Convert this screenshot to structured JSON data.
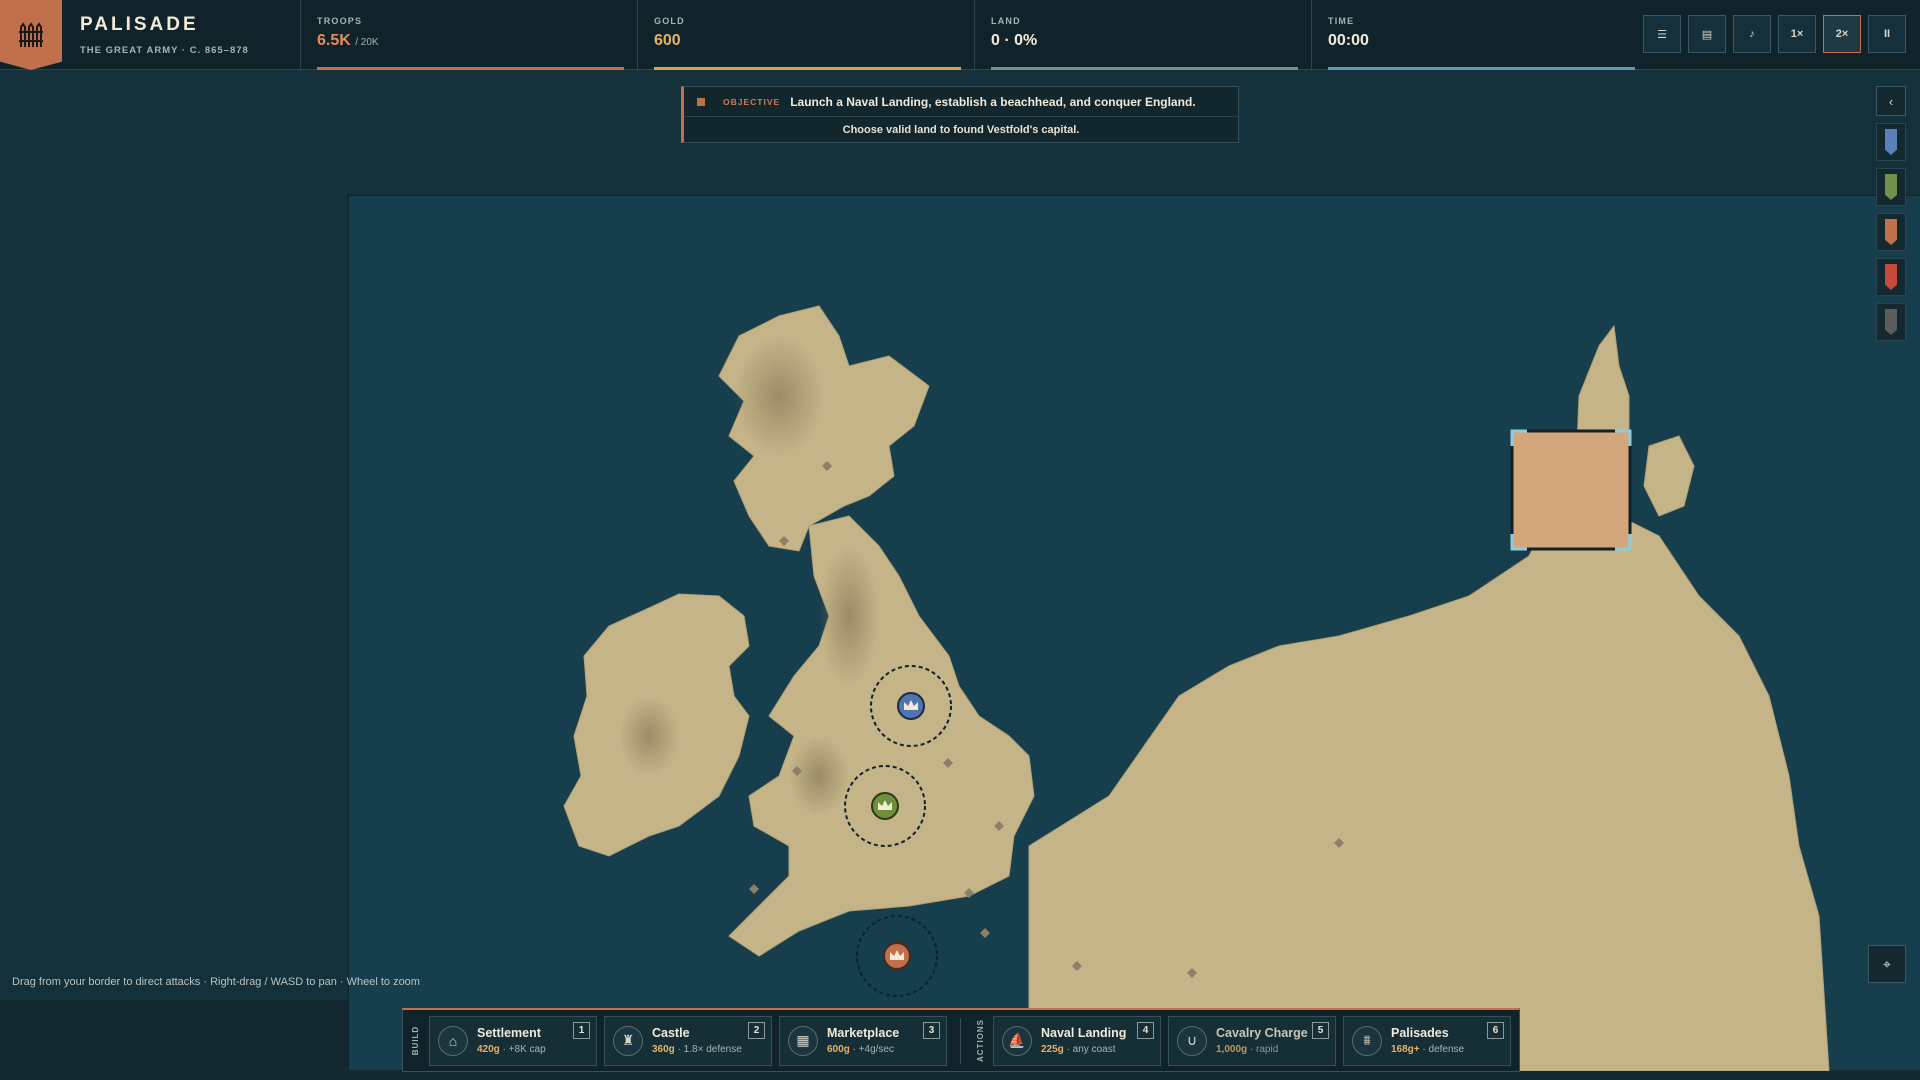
{
  "app": {
    "title": "PALISADE",
    "subtitle": "THE GREAT ARMY · C. 865–878",
    "logo_icon": "palisade-fence-icon"
  },
  "stats": {
    "troops": {
      "label": "TROOPS",
      "value": "6.5K",
      "max": "/ 20K",
      "fill": 1.0,
      "color": "#c0704a"
    },
    "gold": {
      "label": "GOLD",
      "value": "600",
      "fill": 1.0,
      "color": "#d6a25a"
    },
    "land": {
      "label": "LAND",
      "value": "0 · 0%",
      "fill": 1.0,
      "color": "#7a8d8f"
    },
    "time": {
      "label": "TIME",
      "value": "00:00",
      "fill": 1.0,
      "color": "#5a9db0"
    }
  },
  "controls": [
    {
      "name": "menu-button",
      "label": "☰"
    },
    {
      "name": "ledger-button",
      "label": "▤"
    },
    {
      "name": "music-button",
      "label": "♪"
    },
    {
      "name": "speed-1x-button",
      "label": "1×"
    },
    {
      "name": "speed-2x-button",
      "label": "2×",
      "active": true
    },
    {
      "name": "pause-button",
      "label": "II"
    }
  ],
  "objective": {
    "label": "OBJECTIVE",
    "text": "Launch a Naval Landing, establish a beachhead, and conquer England.",
    "instruction": "Choose valid land to found Vestfold's capital."
  },
  "side_panel": {
    "collapse_icon": "‹",
    "banners": [
      "#5b7fb8",
      "#6f8f4a",
      "#c0704a",
      "#c44a3a",
      "#5d5d5d"
    ]
  },
  "map": {
    "capitals": [
      {
        "name": "blue-capital",
        "color": "#4f74b0"
      },
      {
        "name": "green-capital",
        "color": "#6f8f3a"
      },
      {
        "name": "orange-capital",
        "color": "#c0704a"
      }
    ],
    "land_color": "#c4b487",
    "sea_color": "#163e4d"
  },
  "hint": "Drag from your border to direct attacks · Right-drag / WASD to pan · Wheel to zoom",
  "buildbar": {
    "build_label": "BUILD",
    "actions_label": "ACTIONS",
    "build": [
      {
        "name": "settlement",
        "label": "Settlement",
        "cost": "420g",
        "detail": "· +8K cap",
        "key": "1",
        "icon": "⌂"
      },
      {
        "name": "castle",
        "label": "Castle",
        "cost": "360g",
        "detail": "· 1.8× defense",
        "key": "2",
        "icon": "♜"
      },
      {
        "name": "marketplace",
        "label": "Marketplace",
        "cost": "600g",
        "detail": "· +4g/sec",
        "key": "3",
        "icon": "▦"
      }
    ],
    "actions": [
      {
        "name": "naval-landing",
        "label": "Naval Landing",
        "cost": "225g",
        "detail": "· any coast",
        "key": "4",
        "icon": "⛵"
      },
      {
        "name": "cavalry-charge",
        "label": "Cavalry Charge",
        "cost": "1,000g",
        "detail": "· rapid",
        "key": "5",
        "icon": "∪"
      },
      {
        "name": "palisades",
        "label": "Palisades",
        "cost": "168g+",
        "detail": "· defense",
        "key": "6",
        "icon": "⩩"
      }
    ]
  },
  "recenter_icon": "⌖"
}
